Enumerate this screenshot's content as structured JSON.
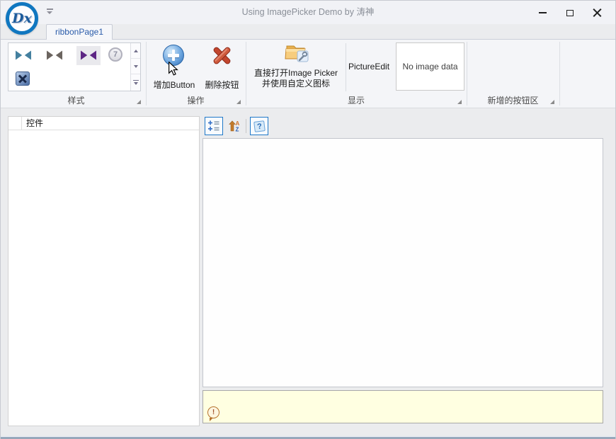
{
  "window": {
    "title": "Using ImagePicker Demo by 涛神"
  },
  "logo": {
    "text": "Dx"
  },
  "ribbon": {
    "tab_label": "ribbonPage1",
    "groups": {
      "style": {
        "caption": "样式",
        "gallery_item7_label": "7"
      },
      "actions": {
        "caption": "操作",
        "add_label": "增加Button",
        "delete_label": "删除按钮"
      },
      "display": {
        "caption": "显示",
        "open_line1": "直接打开Image Picker",
        "open_line2": "并使用自定义图标",
        "picture_edit_label": "PictureEdit",
        "picture_edit_value": "No image data"
      },
      "extra": {
        "caption": "新增的按钮区"
      }
    }
  },
  "controls_grid": {
    "column_header": "控件"
  },
  "property_panel": {
    "help_glyph": "?",
    "description_glyph": "!"
  },
  "icons": {
    "gallery": [
      "vs-theme-teal-icon",
      "vs-theme-gray-icon",
      "vs-theme-purple-icon",
      "style-seven-icon",
      "vs-blend-icon"
    ],
    "toolbar": [
      "categorized-icon",
      "sort-az-icon",
      "help-icon"
    ]
  },
  "colors": {
    "accent": "#1f78c8",
    "tab_text": "#2a5caa",
    "vs_teal": "#44809f",
    "vs_gray": "#6b645f",
    "vs_purple": "#5d2684",
    "description_bg": "#ffffe1",
    "window_bottom": "#45688a"
  }
}
